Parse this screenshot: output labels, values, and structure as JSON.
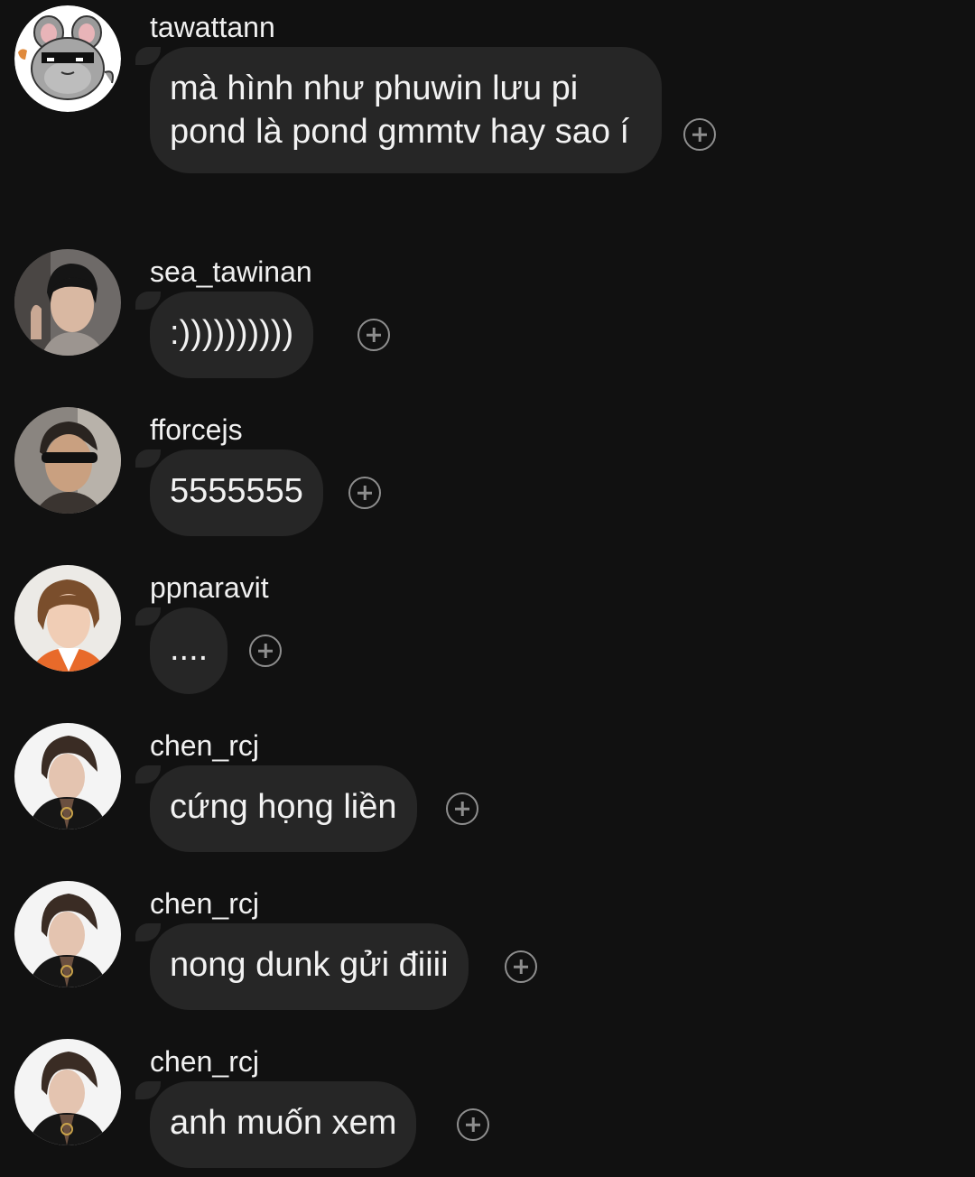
{
  "messages": [
    {
      "username": "tawattann",
      "text": "mà hình như phuwin lưu pi pond là pond gmmtv hay sao í",
      "avatar_icon": "chinchilla-sunglasses-avatar"
    },
    {
      "username": "sea_tawinan",
      "text": ":))))))))))",
      "avatar_icon": "profile-photo-avatar"
    },
    {
      "username": "fforcejs",
      "text": "5555555",
      "avatar_icon": "profile-photo-sunglasses-avatar"
    },
    {
      "username": "ppnaravit",
      "text": "....",
      "avatar_icon": "profile-photo-avatar"
    },
    {
      "username": "chen_rcj",
      "text": "cứng họng liền",
      "avatar_icon": "profile-photo-avatar"
    },
    {
      "username": "chen_rcj",
      "text": "nong dunk gửi điiii",
      "avatar_icon": "profile-photo-avatar"
    },
    {
      "username": "chen_rcj",
      "text": "anh muốn xem",
      "avatar_icon": "profile-photo-avatar"
    }
  ],
  "reaction_icon": "add-reaction-icon",
  "colors": {
    "background": "#111111",
    "bubble": "#262626",
    "text": "#f2f2f2",
    "icon": "#8e8e8e"
  }
}
